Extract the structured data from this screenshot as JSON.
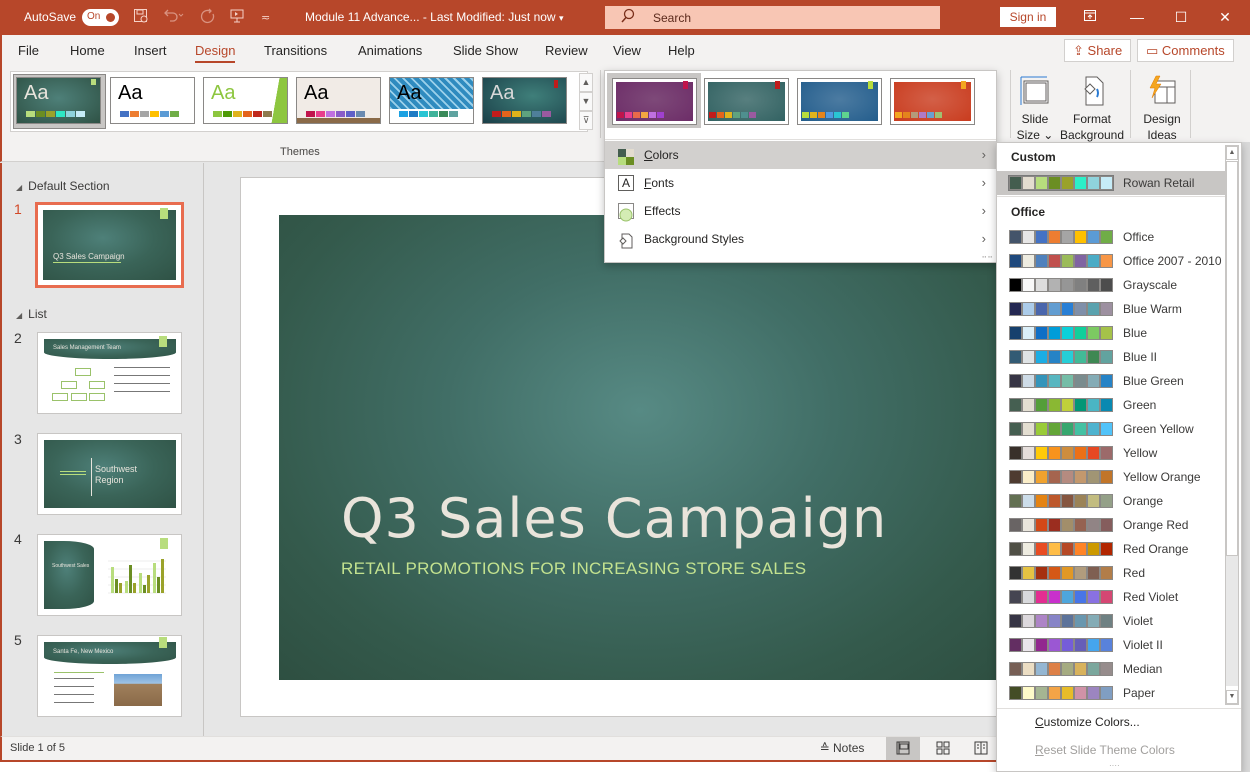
{
  "titlebar": {
    "autosave_label": "AutoSave",
    "autosave_state": "On",
    "document_title": "Module 11 Advance...  -  Last Modified: Just now",
    "title_dropdown": "▾",
    "search_placeholder": "Search",
    "signin_label": "Sign in",
    "qat_icons": [
      "save-icon",
      "undo-icon",
      "redo-icon",
      "present-icon",
      "customize-qat-icon"
    ],
    "window_buttons": {
      "ribbon_display": "⧉",
      "minimize": "—",
      "maximize": "☐",
      "close": "✕"
    }
  },
  "tabs": {
    "items": [
      "File",
      "Home",
      "Insert",
      "Design",
      "Transitions",
      "Animations",
      "Slide Show",
      "Review",
      "View",
      "Help"
    ],
    "active": "Design",
    "share_label": "Share",
    "comments_label": "Comments"
  },
  "ribbon": {
    "themes_group_label": "Themes",
    "themes": [
      {
        "label": "Aa",
        "bg": "#3d6558",
        "text": "#e8e4dc",
        "swatches": [
          "#b8dd7d",
          "#6b8e23",
          "#9aa22a",
          "#2de7c4",
          "#8ed3dc",
          "#c6ecf7"
        ],
        "selected": true
      },
      {
        "label": "Aa",
        "bg": "#ffffff",
        "text": "#000000",
        "swatches": [
          "#4472c4",
          "#ed7d31",
          "#a5a5a5",
          "#ffc000",
          "#5b9bd5",
          "#70ad47"
        ],
        "selected": false
      },
      {
        "label": "Aa",
        "bg": "#ffffff",
        "text": "#8dc63f",
        "swatches": [
          "#8dc63f",
          "#4e9a06",
          "#e0b31c",
          "#e4641c",
          "#c0281c",
          "#8e7a4e"
        ],
        "selected": false
      },
      {
        "label": "Aa",
        "bg": "#f1ebe6",
        "text": "#000000",
        "swatches": [
          "#c0144c",
          "#e83e8c",
          "#c070e0",
          "#8a5cc8",
          "#6060c8",
          "#6a8ab0"
        ],
        "selected": false
      },
      {
        "label": "Aa",
        "bg": "#2f8bbf",
        "text": "#000000",
        "swatches": [
          "#1ba1e2",
          "#1e7bc4",
          "#29c5d3",
          "#3fb39a",
          "#3a8a5a",
          "#5fa3a0"
        ],
        "selected": false
      },
      {
        "label": "Aa",
        "bg": "#1f4f5a",
        "text": "#d8d8d8",
        "swatches": [
          "#c01c1c",
          "#e4641c",
          "#e0b31c",
          "#5fa37e",
          "#4f7f9a",
          "#9a5aa0"
        ],
        "selected": false
      }
    ],
    "variants": [
      {
        "bg": "#6b2a66",
        "tag": "#c0144c",
        "swatches": [
          "#c0144c",
          "#e83e8c",
          "#e86a4a",
          "#f4a640",
          "#c070e0",
          "#a040d0"
        ],
        "selected": true
      },
      {
        "bg": "#2e5f5f",
        "tag": "#c01c1c",
        "swatches": [
          "#c01c1c",
          "#e4641c",
          "#e0b31c",
          "#5fa37e",
          "#4f8f8f",
          "#9a5aa0"
        ],
        "selected": false
      },
      {
        "bg": "#1f5a8a",
        "tag": "#b8dd3d",
        "swatches": [
          "#b8dd3d",
          "#e0b31c",
          "#e4841c",
          "#4f9ae0",
          "#29c5d3",
          "#5fd38e"
        ],
        "selected": false
      },
      {
        "bg": "#c8381a",
        "tag": "#f4a620",
        "swatches": [
          "#f4a620",
          "#e4841c",
          "#b49a7a",
          "#b07ac8",
          "#6aa0d0",
          "#a0c070"
        ],
        "selected": false
      }
    ],
    "slide_size_label": "Slide Size",
    "format_background_label": "Format Background",
    "design_ideas_label": "Design Ideas"
  },
  "variants_menu": {
    "items": [
      {
        "label": "Colors",
        "mnemonic": "C",
        "icon": "color-palette-icon",
        "highlighted": true
      },
      {
        "label": "Fonts",
        "mnemonic": "F",
        "icon": "font-icon",
        "highlighted": false
      },
      {
        "label": "Effects",
        "mnemonic": "",
        "icon": "effects-icon",
        "highlighted": false
      },
      {
        "label": "Background Styles",
        "mnemonic": "",
        "icon": "background-styles-icon",
        "highlighted": false
      }
    ]
  },
  "colors_menu": {
    "custom_heading": "Custom",
    "office_heading": "Office",
    "custom": [
      {
        "name": "Rowan Retail",
        "colors": [
          "#445d4f",
          "#e3dccf",
          "#b7dd7d",
          "#6b8e23",
          "#9aa22a",
          "#2cf0c8",
          "#8fd3dc",
          "#c6ecf7"
        ],
        "selected": true
      }
    ],
    "office": [
      {
        "name": "Office",
        "colors": [
          "#44546a",
          "#e7e6e6",
          "#4472c4",
          "#ed7d31",
          "#a5a5a5",
          "#ffc000",
          "#5b9bd5",
          "#70ad47"
        ]
      },
      {
        "name": "Office 2007 - 2010",
        "colors": [
          "#1f497d",
          "#eeece1",
          "#4f81bd",
          "#c0504d",
          "#9bbb59",
          "#8064a2",
          "#4bacc6",
          "#f79646"
        ]
      },
      {
        "name": "Grayscale",
        "colors": [
          "#000000",
          "#f8f8f8",
          "#dddddd",
          "#b2b2b2",
          "#969696",
          "#808080",
          "#5f5f5f",
          "#4d4d4d"
        ]
      },
      {
        "name": "Blue Warm",
        "colors": [
          "#242852",
          "#acccea",
          "#4a66ac",
          "#629dd1",
          "#297fd5",
          "#7f8fa9",
          "#5aa2ae",
          "#9d90a0"
        ]
      },
      {
        "name": "Blue",
        "colors": [
          "#17406d",
          "#dbeff9",
          "#0f6fc6",
          "#009dd9",
          "#0bd0d9",
          "#10cf9b",
          "#7cca62",
          "#a5c249"
        ]
      },
      {
        "name": "Blue II",
        "colors": [
          "#335b74",
          "#dfe3e5",
          "#1cade4",
          "#2683c6",
          "#27ced7",
          "#42ba97",
          "#3e8853",
          "#62a39f"
        ]
      },
      {
        "name": "Blue Green",
        "colors": [
          "#373545",
          "#cedbe6",
          "#3494ba",
          "#58b6c0",
          "#75bda7",
          "#7a8c8e",
          "#84acb6",
          "#2683c6"
        ]
      },
      {
        "name": "Green",
        "colors": [
          "#455f51",
          "#e3ded1",
          "#549e39",
          "#8ab833",
          "#c0cf3a",
          "#029676",
          "#4ab5c4",
          "#0989b1"
        ]
      },
      {
        "name": "Green Yellow",
        "colors": [
          "#455f51",
          "#e3ded1",
          "#99cb38",
          "#63a537",
          "#37a76f",
          "#44c1a3",
          "#4eb3cf",
          "#51c3f9"
        ]
      },
      {
        "name": "Yellow",
        "colors": [
          "#39302a",
          "#e5dedb",
          "#ffca08",
          "#f8931d",
          "#ce8d3e",
          "#ec7016",
          "#e64823",
          "#9c6a6a"
        ]
      },
      {
        "name": "Yellow Orange",
        "colors": [
          "#4e3b30",
          "#fbeec9",
          "#f0a22e",
          "#a5644e",
          "#b58b80",
          "#c3986d",
          "#a19574",
          "#c17529"
        ]
      },
      {
        "name": "Orange",
        "colors": [
          "#637052",
          "#ccddea",
          "#e48312",
          "#bd582c",
          "#865640",
          "#9b8357",
          "#c2bc80",
          "#94a088"
        ]
      },
      {
        "name": "Orange Red",
        "colors": [
          "#696464",
          "#e9e5dc",
          "#d34817",
          "#9b2d1f",
          "#a28e6a",
          "#956251",
          "#918485",
          "#855d5d"
        ]
      },
      {
        "name": "Red Orange",
        "colors": [
          "#505046",
          "#eeece1",
          "#e84c22",
          "#ffbd47",
          "#b64926",
          "#ff8427",
          "#cc9900",
          "#b22600"
        ]
      },
      {
        "name": "Red",
        "colors": [
          "#323232",
          "#e5c243",
          "#a5300f",
          "#d55816",
          "#e19825",
          "#b19c7d",
          "#7f5f52",
          "#b27d49"
        ]
      },
      {
        "name": "Red Violet",
        "colors": [
          "#454551",
          "#d8d9dc",
          "#e32d91",
          "#c830cc",
          "#4ea6dc",
          "#4775e7",
          "#8971e1",
          "#d54773"
        ]
      },
      {
        "name": "Violet",
        "colors": [
          "#373545",
          "#dcd8dc",
          "#ad84c6",
          "#8784c7",
          "#5d739a",
          "#6997af",
          "#84acb6",
          "#6f8183"
        ]
      },
      {
        "name": "Violet II",
        "colors": [
          "#632e62",
          "#eae5eb",
          "#92278f",
          "#9b57d3",
          "#755dd9",
          "#665eb8",
          "#45a5ed",
          "#5982db"
        ]
      },
      {
        "name": "Median",
        "colors": [
          "#775f55",
          "#ebddc3",
          "#94b6d2",
          "#dd8047",
          "#a5ab81",
          "#d8b25c",
          "#7ba79d",
          "#968c8c"
        ]
      },
      {
        "name": "Paper",
        "colors": [
          "#444d26",
          "#fefac9",
          "#a5b592",
          "#f3a447",
          "#e7bc29",
          "#d092a7",
          "#9c85c0",
          "#809ec2"
        ]
      }
    ],
    "customize_label": "Customize Colors...",
    "customize_mnemonic": "C",
    "reset_label": "Reset Slide Theme Colors",
    "reset_mnemonic": "R",
    "reset_disabled": true
  },
  "thumbnails": {
    "sections": [
      {
        "name": "Default Section",
        "slides": [
          1
        ]
      },
      {
        "name": "List",
        "slides": [
          2,
          3,
          4,
          5
        ]
      }
    ],
    "slides": [
      {
        "number": "1",
        "title": "Q3 Sales Campaign",
        "active": true
      },
      {
        "number": "2",
        "title": "Sales Management Team",
        "active": false
      },
      {
        "number": "3",
        "title": "Southwest Region",
        "active": false
      },
      {
        "number": "4",
        "title": "Southwest Sales",
        "active": false
      },
      {
        "number": "5",
        "title": "Santa Fe, New Mexico",
        "active": false
      }
    ]
  },
  "slide": {
    "title": "Q3 Sales Campaign",
    "subtitle": "RETAIL PROMOTIONS FOR INCREASING STORE SALES"
  },
  "statusbar": {
    "slide_indicator": "Slide 1 of 5",
    "notes_label": "Notes",
    "views": [
      "normal-view",
      "slide-sorter-view",
      "reading-view"
    ],
    "active_view": "normal-view"
  }
}
